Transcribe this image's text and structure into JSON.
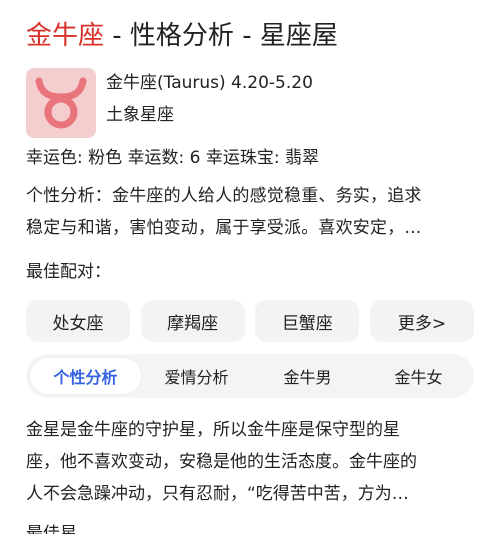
{
  "title": {
    "highlight": "金牛座",
    "rest": " - 性格分析 - 星座屋"
  },
  "header": {
    "logo_icon": "taurus-symbol-icon",
    "logo_color": "#e8747c",
    "name_line": "金牛座(Taurus) 4.20-5.20",
    "element": "土象星座"
  },
  "lucky": "幸运色: 粉色 幸运数: 6 幸运珠宝: 翡翠",
  "analysis": {
    "line1": "个性分析：金牛座的人给人的感觉稳重、务实，追求",
    "line2": "稳定与和谐，害怕变动，属于享受派。喜欢安定，…"
  },
  "match_label": "最佳配对：",
  "matches": [
    "处女座",
    "摩羯座",
    "巨蟹座",
    "更多>"
  ],
  "tabs": [
    "个性分析",
    "爱情分析",
    "金牛男",
    "金牛女"
  ],
  "active_tab": 0,
  "accent_color": "#3464e0",
  "description": {
    "line1": "金星是金牛座的守护星，所以金牛座是保守型的星",
    "line2": "座，他不喜欢变动，安稳是他的生活态度。金牛座的",
    "line3": "人不会急躁冲动，只有忍耐，“吃得苦中苦，方为…"
  },
  "cut_text": "最佳星..."
}
